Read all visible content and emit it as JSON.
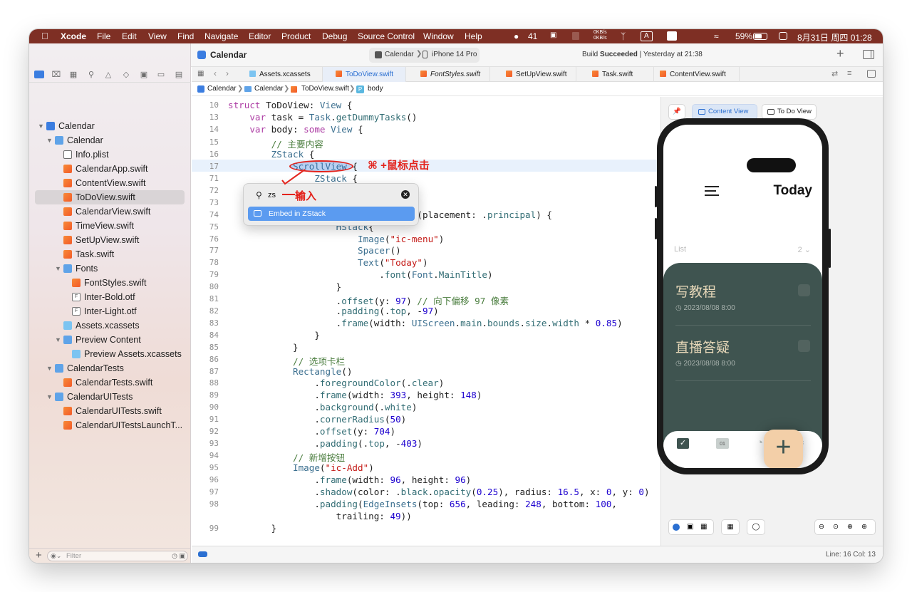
{
  "menubar": {
    "items": [
      "Xcode",
      "File",
      "Edit",
      "View",
      "Find",
      "Navigate",
      "Editor",
      "Product",
      "Debug",
      "Source Control",
      "Window",
      "Help"
    ],
    "status": {
      "wechat": "41",
      "net_up": "0KB/s",
      "net_down": "0KB/s",
      "input": "A",
      "battery": "59%",
      "datetime": "8月31日 周四  01:28"
    }
  },
  "toolbar": {
    "project": "Calendar",
    "scheme": "Calendar",
    "device": "iPhone 14 Pro",
    "build_prefix": "Build",
    "build_status": "Succeeded",
    "build_time": "| Yesterday at 21:38"
  },
  "sidebar": {
    "items": [
      {
        "label": "Calendar",
        "kind": "xcproj"
      },
      {
        "label": "Calendar",
        "kind": "folder"
      },
      {
        "label": "Info.plist",
        "kind": "plist"
      },
      {
        "label": "CalendarApp.swift",
        "kind": "swift"
      },
      {
        "label": "ContentView.swift",
        "kind": "swift"
      },
      {
        "label": "ToDoView.swift",
        "kind": "swift"
      },
      {
        "label": "CalendarView.swift",
        "kind": "swift"
      },
      {
        "label": "TimeView.swift",
        "kind": "swift"
      },
      {
        "label": "SetUpView.swift",
        "kind": "swift"
      },
      {
        "label": "Task.swift",
        "kind": "swift"
      },
      {
        "label": "Fonts",
        "kind": "folder"
      },
      {
        "label": "FontStyles.swift",
        "kind": "swift"
      },
      {
        "label": "Inter-Bold.otf",
        "kind": "font"
      },
      {
        "label": "Inter-Light.otf",
        "kind": "font"
      },
      {
        "label": "Assets.xcassets",
        "kind": "assets"
      },
      {
        "label": "Preview Content",
        "kind": "folder"
      },
      {
        "label": "Preview Assets.xcassets",
        "kind": "assets"
      },
      {
        "label": "CalendarTests",
        "kind": "folder"
      },
      {
        "label": "CalendarTests.swift",
        "kind": "swift"
      },
      {
        "label": "CalendarUITests",
        "kind": "folder"
      },
      {
        "label": "CalendarUITests.swift",
        "kind": "swift"
      },
      {
        "label": "CalendarUITestsLaunchT...",
        "kind": "swift"
      }
    ],
    "filter_placeholder": "Filter"
  },
  "tabs": [
    "Assets.xcassets",
    "ToDoView.swift",
    "FontStyles.swift",
    "SetUpView.swift",
    "Task.swift",
    "ContentView.swift"
  ],
  "jumpbar": [
    "Calendar",
    "Calendar",
    "ToDoView.swift",
    "body"
  ],
  "code": {
    "line_numbers": [
      "10",
      "13",
      "14",
      "15",
      "16",
      "17",
      "71",
      "72",
      "73",
      "74",
      "75",
      "76",
      "77",
      "78",
      "79",
      "80",
      "81",
      "82",
      "83",
      "84",
      "85",
      "86",
      "87",
      "88",
      "89",
      "90",
      "91",
      "92",
      "93",
      "94",
      "95",
      "96",
      "97",
      "98",
      "99"
    ],
    "lines": [
      "struct ToDoView: View {",
      "    var task = Task.getDummyTasks()",
      "    var body: some View {",
      "        // 主要内容",
      "        ZStack {",
      "            ScrollView {",
      "                ZStack {",
      "",
      "",
      "                        ToolbarItem(placement: .principal) {",
      "                    HStack{",
      "                        Image(\"ic-menu\")",
      "                        Spacer()",
      "                        Text(\"Today\")",
      "                            .font(Font.MainTitle)",
      "                    }",
      "                    .offset(y: 97) // 向下偏移 97 像素",
      "                    .padding(.top, -97)",
      "                    .frame(width: UIScreen.main.bounds.size.width * 0.85)",
      "                }",
      "            }",
      "            // 选项卡栏",
      "            Rectangle()",
      "                .foregroundColor(.clear)",
      "                .frame(width: 393, height: 148)",
      "                .background(.white)",
      "                .cornerRadius(50)",
      "                .offset(y: 704)",
      "                .padding(.top, -403)",
      "            // 新增按钮",
      "            Image(\"ic-Add\")",
      "                .frame(width: 96, height: 96)",
      "                .shadow(color: .black.opacity(0.25), radius: 16.5, x: 0, y: 0)",
      "                .padding(EdgeInsets(top: 656, leading: 248, bottom: 100,",
      "                    trailing: 49))",
      "        }",
      ""
    ]
  },
  "popup": {
    "query": "zs",
    "result": "Embed in ZStack"
  },
  "annotations": {
    "click": "⌘ +鼠标点击",
    "type": "输入"
  },
  "preview": {
    "content_view_btn": "Content View",
    "todo_view_btn": "To Do View",
    "title": "Today",
    "list_label": "List",
    "list_count": "2",
    "tasks": [
      {
        "title": "写教程",
        "time": "2023/08/08 8:00"
      },
      {
        "title": "直播答疑",
        "time": "2023/08/08 8:00"
      }
    ],
    "add_symbol": "+",
    "calendar_tab_number": "01"
  },
  "status": {
    "position": "Line: 16  Col: 13"
  },
  "colors": {
    "menubar": "#7e2f24",
    "card": "#3f5450",
    "add_button": "#f3cfa8",
    "highlight": "#2b6fd1",
    "annotation": "#e3231c"
  }
}
